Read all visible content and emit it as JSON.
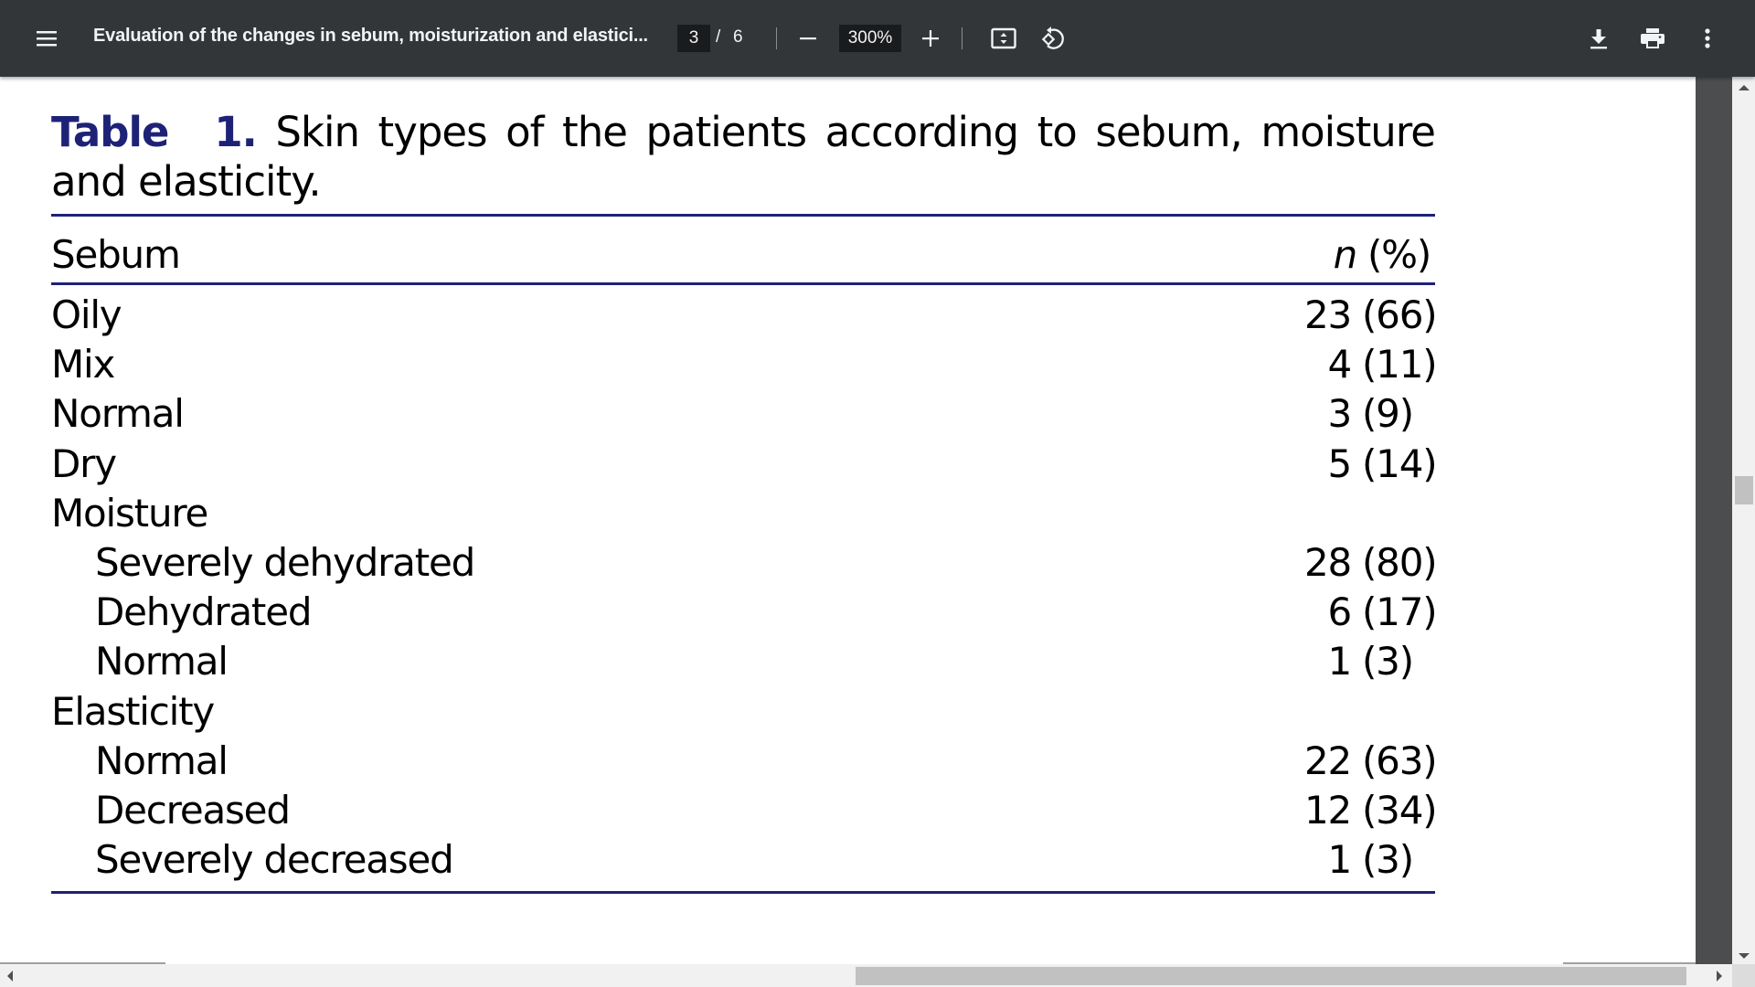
{
  "toolbar": {
    "menu_icon": "hamburger-menu-icon",
    "title": "Evaluation of the changes in sebum, moisturization and elastici...",
    "current_page": "3",
    "page_separator": "/",
    "total_pages": "6",
    "zoom_out_icon": "minus-icon",
    "zoom_level": "300%",
    "zoom_in_icon": "plus-icon",
    "fit_icon": "fit-to-page-icon",
    "rotate_icon": "rotate-counterclockwise-icon",
    "download_icon": "download-icon",
    "print_icon": "print-icon",
    "more_icon": "more-vertical-icon"
  },
  "document": {
    "caption": {
      "label": "Table 1.",
      "line1": "Skin types of the patients according to sebum, moisture",
      "line2": "and elasticity."
    },
    "table": {
      "header": {
        "category": "Sebum",
        "n": "n",
        "pct": "(%)"
      },
      "rows": [
        {
          "label": "Oily",
          "n": "23",
          "pct": "(66)",
          "indent": false
        },
        {
          "label": "Mix",
          "n": "4",
          "pct": "(11)",
          "indent": false
        },
        {
          "label": "Normal",
          "n": "3",
          "pct": "(9)",
          "indent": false
        },
        {
          "label": "Dry",
          "n": "5",
          "pct": "(14)",
          "indent": false
        },
        {
          "label": "Moisture",
          "n": "",
          "pct": "",
          "indent": false
        },
        {
          "label": "Severely dehydrated",
          "n": "28",
          "pct": "(80)",
          "indent": true
        },
        {
          "label": "Dehydrated",
          "n": "6",
          "pct": "(17)",
          "indent": true
        },
        {
          "label": "Normal",
          "n": "1",
          "pct": "(3)",
          "indent": true
        },
        {
          "label": "Elasticity",
          "n": "",
          "pct": "",
          "indent": false
        },
        {
          "label": "Normal",
          "n": "22",
          "pct": "(63)",
          "indent": true
        },
        {
          "label": "Decreased",
          "n": "12",
          "pct": "(34)",
          "indent": true
        },
        {
          "label": "Severely decreased",
          "n": "1",
          "pct": "(3)",
          "indent": true
        }
      ]
    }
  },
  "colors": {
    "toolbar_bg": "#323639",
    "accent_navy": "#1e2277"
  }
}
